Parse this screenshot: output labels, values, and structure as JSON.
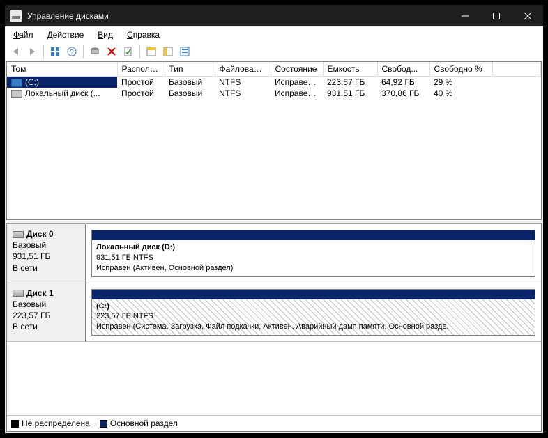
{
  "title": "Управление дисками",
  "menu": {
    "file": "Файл",
    "action": "Действие",
    "view": "Вид",
    "help": "Справка"
  },
  "columns": {
    "volume": "Том",
    "layout": "Располо...",
    "type": "Тип",
    "fs": "Файловая с...",
    "status": "Состояние",
    "capacity": "Емкость",
    "free": "Свобод...",
    "freepct": "Свободно %"
  },
  "vols": [
    {
      "icon": "sel",
      "name": "(C:)",
      "layout": "Простой",
      "type": "Базовый",
      "fs": "NTFS",
      "status": "Исправен...",
      "capacity": "223,57 ГБ",
      "free": "64,92 ГБ",
      "freepct": "29 %"
    },
    {
      "icon": "",
      "name": "Локальный диск (...",
      "layout": "Простой",
      "type": "Базовый",
      "fs": "NTFS",
      "status": "Исправен...",
      "capacity": "931,51 ГБ",
      "free": "370,86 ГБ",
      "freepct": "40 %"
    }
  ],
  "disks": [
    {
      "name": "Диск 0",
      "type": "Базовый",
      "size": "931,51 ГБ",
      "state": "В сети",
      "region": {
        "title": "Локальный диск  (D:)",
        "line2": "931,51 ГБ NTFS",
        "line3": "Исправен (Активен, Основной раздел)",
        "hatched": false
      }
    },
    {
      "name": "Диск 1",
      "type": "Базовый",
      "size": "223,57 ГБ",
      "state": "В сети",
      "region": {
        "title": "(C:)",
        "line2": "223,57 ГБ NTFS",
        "line3": "Исправен (Система, Загрузка, Файл подкачки, Активен, Аварийный дамп памяти, Основной разде.",
        "hatched": true
      }
    }
  ],
  "legend": {
    "unalloc": "Не распределена",
    "primary": "Основной раздел"
  }
}
